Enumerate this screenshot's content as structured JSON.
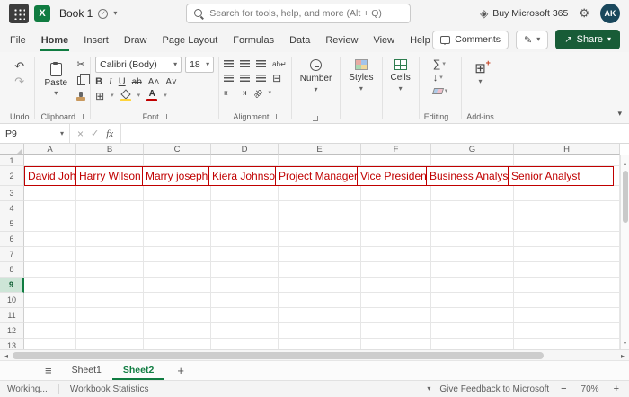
{
  "title_bar": {
    "workbook_name": "Book 1",
    "search_placeholder": "Search for tools, help, and more (Alt + Q)",
    "buy_label": "Buy Microsoft 365",
    "avatar_initials": "AK"
  },
  "menu_bar": {
    "tabs": [
      "File",
      "Home",
      "Insert",
      "Draw",
      "Page Layout",
      "Formulas",
      "Data",
      "Review",
      "View",
      "Help"
    ],
    "active_tab": "Home",
    "comments_label": "Comments",
    "share_label": "Share"
  },
  "ribbon": {
    "undo_group": "Undo",
    "clipboard_group": "Clipboard",
    "paste_label": "Paste",
    "font_group": "Font",
    "font_name": "Calibri (Body)",
    "font_size": "18",
    "alignment_group": "Alignment",
    "number_group": "Number",
    "styles_group": "Styles",
    "cells_group": "Cells",
    "editing_group": "Editing",
    "addins_group": "Add-ins"
  },
  "formula_bar": {
    "name_box": "P9",
    "fx_label": "fx",
    "formula_value": ""
  },
  "grid": {
    "column_headers": [
      "A",
      "B",
      "C",
      "D",
      "E",
      "F",
      "G",
      "H"
    ],
    "row_headers": [
      "1",
      "2",
      "3",
      "4",
      "5",
      "6",
      "7",
      "8",
      "9",
      "10",
      "11",
      "12",
      "13"
    ],
    "selected_row": "9",
    "row2_cells": [
      "David John",
      "Harry Wilson",
      "Marry joseph",
      "Kiera Johnson",
      "Project Manager",
      "Vice President",
      "Business Analyst",
      "Senior Analyst"
    ]
  },
  "sheet_bar": {
    "sheets": [
      "Sheet1",
      "Sheet2"
    ],
    "active_sheet": "Sheet2",
    "add_sheet_label": "+"
  },
  "status_bar": {
    "mode": "Working...",
    "statistics_label": "Workbook Statistics",
    "feedback_label": "Give Feedback to Microsoft",
    "zoom_out": "−",
    "zoom_level": "70%",
    "zoom_in": "+"
  },
  "colors": {
    "excel_green": "#107c41",
    "share_green": "#185c37",
    "data_red": "#c00000",
    "avatar_bg": "#19475c"
  }
}
